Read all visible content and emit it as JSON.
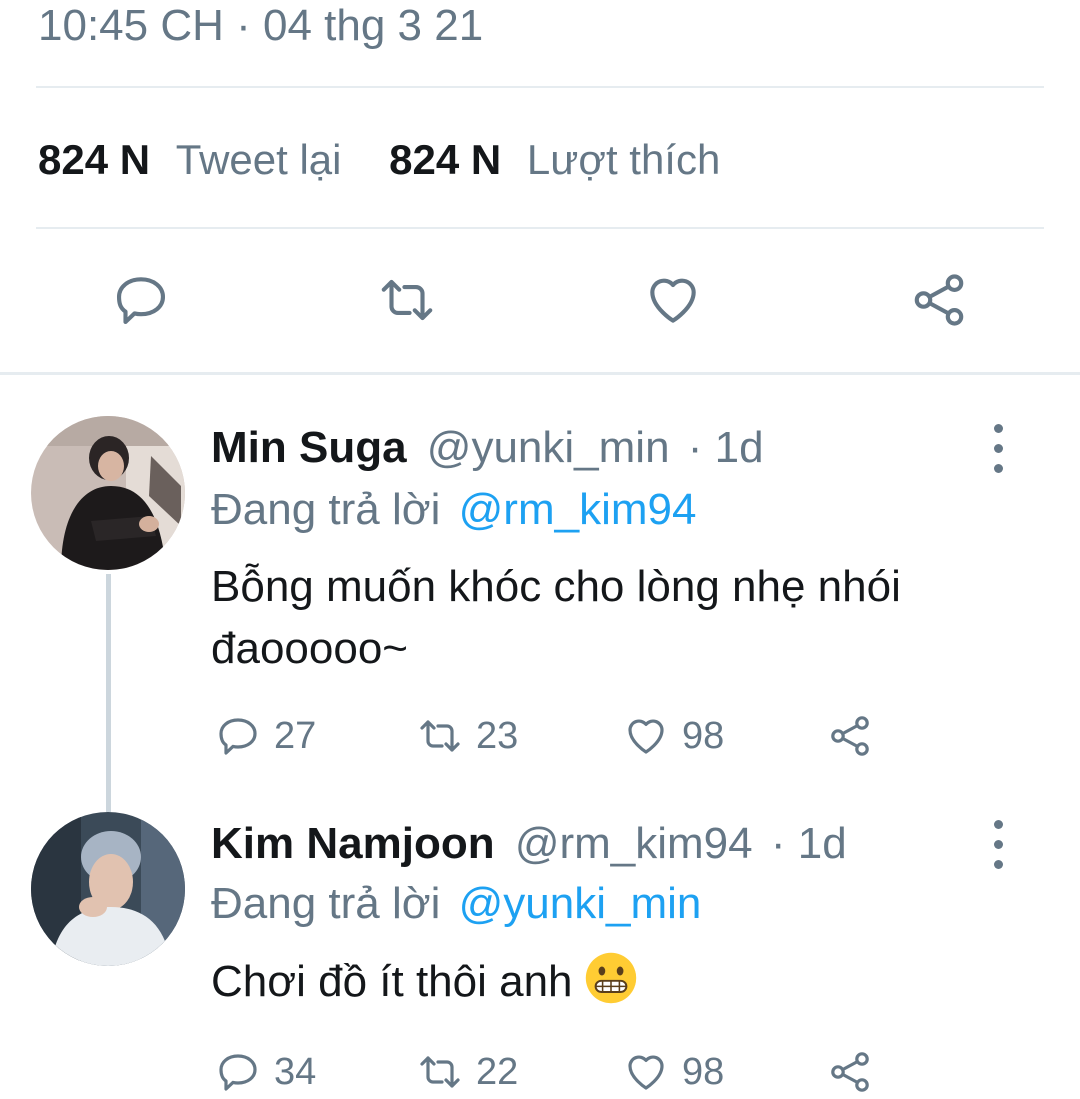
{
  "tweet": {
    "timestamp": "10:45 CH · 04 thg 3 21",
    "retweets_count": "824 N",
    "retweets_label": "Tweet lại",
    "likes_count": "824 N",
    "likes_label": "Lượt thích",
    "actions": [
      "reply-icon",
      "retweet-icon",
      "like-icon",
      "share-icon"
    ]
  },
  "replies": [
    {
      "name": "Min Suga",
      "handle": "@yunki_min",
      "time": "· 1d",
      "replying_label": "Đang trả lời",
      "replying_to": "@rm_kim94",
      "text": "Bỗng muốn khóc cho lòng nhẹ nhói đaooooo~",
      "reply_count": "27",
      "retweet_count": "23",
      "like_count": "98"
    },
    {
      "name": "Kim Namjoon",
      "handle": "@rm_kim94",
      "time": "· 1d",
      "replying_label": "Đang trả lời",
      "replying_to": "@yunki_min",
      "text": "Chơi đồ ít thôi anh",
      "emoji": "grimacing-face-emoji",
      "reply_count": "34",
      "retweet_count": "22",
      "like_count": "98"
    }
  ],
  "colors": {
    "text_primary": "#14171a",
    "text_secondary": "#657786",
    "mention": "#1da1f2",
    "divider": "#e6ecf0"
  }
}
